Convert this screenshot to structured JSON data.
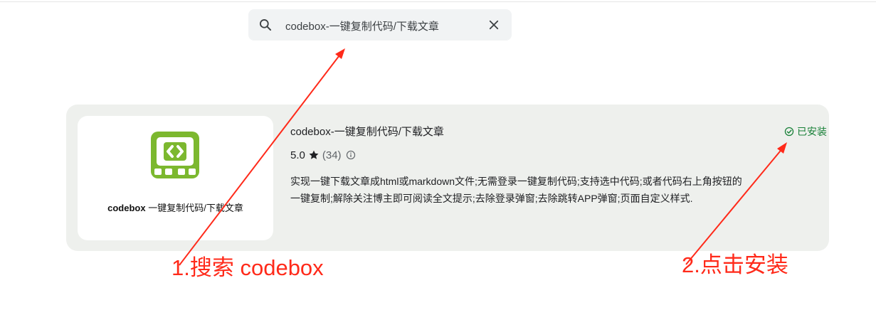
{
  "search": {
    "query": "codebox-一键复制代码/下载文章"
  },
  "extension": {
    "title": "codebox-一键复制代码/下载文章",
    "rating": "5.0",
    "review_count": "(34)",
    "status": "已安装",
    "description_line1": "实现一键下载文章成html或markdown文件;无需登录一键复制代码;支持选中代码;或者代码右上角按钮的",
    "description_line2": "一键复制;解除关注博主即可阅读全文提示;去除登录弹窗;去除跳转APP弹窗;页面自定义样式.",
    "thumbnail_caption_bold": "codebox",
    "thumbnail_caption_rest": " 一键复制代码/下载文章",
    "logo_color": "#7cb82f",
    "status_color": "#188038"
  },
  "annotations": {
    "step1": "1.搜索 codebox",
    "step2": "2.点击安装",
    "color": "#ff2a1a"
  }
}
